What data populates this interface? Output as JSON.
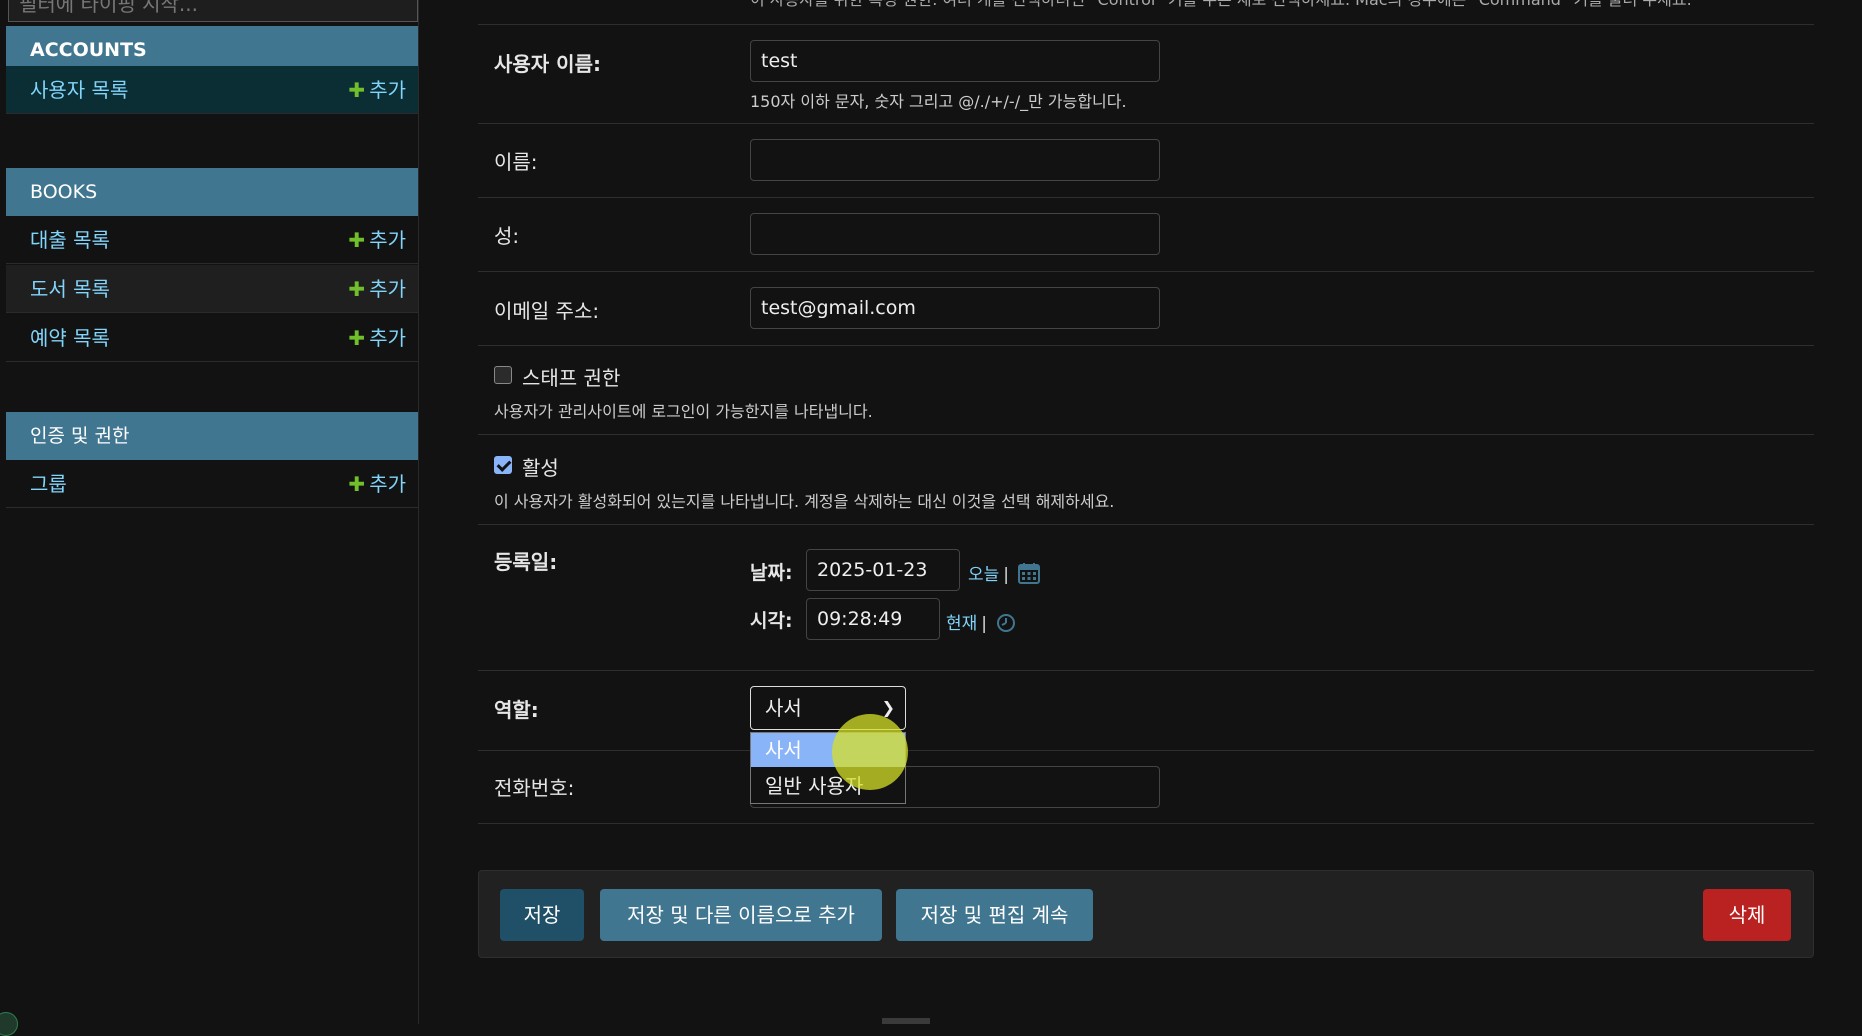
{
  "sidebar": {
    "filter_placeholder": "필터에 타이핑 시작...",
    "modules": [
      {
        "caption": "ACCOUNTS",
        "models": [
          {
            "label": "사용자 목록",
            "add": "추가"
          }
        ]
      },
      {
        "caption": "BOOKS",
        "models": [
          {
            "label": "대출 목록",
            "add": "추가"
          },
          {
            "label": "도서 목록",
            "add": "추가"
          },
          {
            "label": "예약 목록",
            "add": "추가"
          }
        ]
      },
      {
        "caption": "인증 및 권한",
        "models": [
          {
            "label": "그룹",
            "add": "추가"
          }
        ]
      }
    ]
  },
  "form": {
    "top_hint": "이 사용자를 위한 특정 권한. 여러 개를 선택하려면 \"Control\" 키를 누른 채로 선택하세요. Mac의 경우에는 \"Command\" 키를 눌러 주세요.",
    "username": {
      "label": "사용자 이름:",
      "value": "test",
      "help": "150자 이하 문자, 숫자 그리고 @/./+/-/_만 가능합니다."
    },
    "first_name": {
      "label": "이름:",
      "value": ""
    },
    "last_name": {
      "label": "성:",
      "value": ""
    },
    "email": {
      "label": "이메일 주소:",
      "value": "test@gmail.com"
    },
    "is_staff": {
      "label": "스태프 권한",
      "checked": false,
      "help": "사용자가 관리사이트에 로그인이 가능한지를 나타냅니다."
    },
    "is_active": {
      "label": "활성",
      "checked": true,
      "help": "이 사용자가 활성화되어 있는지를 나타냅니다. 계정을 삭제하는 대신 이것을 선택 해제하세요."
    },
    "date_joined": {
      "label": "등록일:",
      "date_label": "날짜:",
      "date_value": "2025-01-23",
      "today": "오늘",
      "time_label": "시각:",
      "time_value": "09:28:49",
      "now": "현재"
    },
    "role": {
      "label": "역할:",
      "value": "사서",
      "options": [
        "사서",
        "일반 사용자"
      ],
      "highlighted": "사서"
    },
    "phone": {
      "label": "전화번호:",
      "value": ""
    }
  },
  "actions": {
    "save": "저장",
    "save_add_another": "저장 및 다른 이름으로 추가",
    "save_continue": "저장 및 편집 계속",
    "delete": "삭제"
  },
  "colors": {
    "caption_bg": "#417690",
    "link": "#81d4fa",
    "add_plus": "#70bf2b",
    "selected_row": "#0b2e35",
    "delete": "#ba2121",
    "highlight_option": "#8ab4f8"
  },
  "icons": [
    "plus-icon",
    "calendar-icon",
    "clock-icon",
    "chevron-down-icon"
  ]
}
